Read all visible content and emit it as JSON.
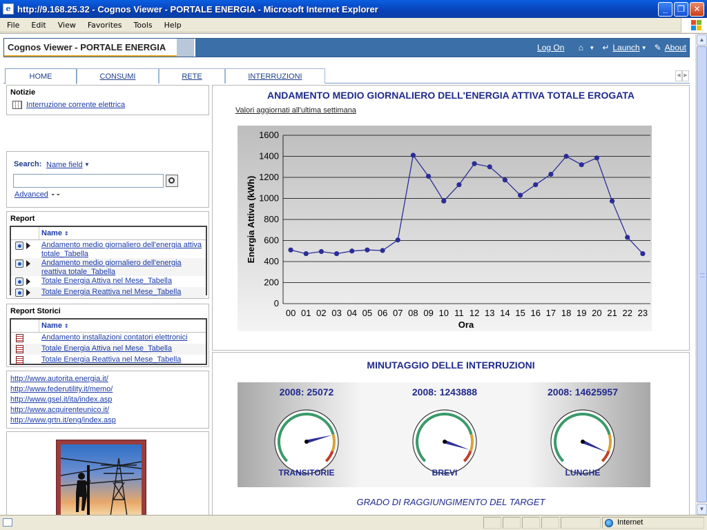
{
  "window": {
    "title": "http://9.168.25.32 - Cognos Viewer - PORTALE ENERGIA - Microsoft Internet Explorer",
    "menu": [
      "File",
      "Edit",
      "View",
      "Favorites",
      "Tools",
      "Help"
    ]
  },
  "header": {
    "brand": "Cognos Viewer - PORTALE ENERGIA",
    "log_on": "Log On",
    "launch": "Launch",
    "about": "About"
  },
  "tabs": [
    {
      "label": "HOME",
      "active": true
    },
    {
      "label": "CONSUMI",
      "active": false
    },
    {
      "label": "RETE",
      "active": false
    },
    {
      "label": "INTERRUZIONI",
      "active": false
    }
  ],
  "notizie": {
    "title": "Notizie",
    "item": "Interruzione corrente elettrica"
  },
  "search": {
    "label": "Search:",
    "field_selector": "Name field",
    "value": "",
    "advanced": "Advanced"
  },
  "report": {
    "title": "Report",
    "column": "Name",
    "items": [
      "Andamento medio giornaliero dell'energia attiva totale_Tabella",
      "Andamento medio giornaliero dell'energia reattiva totale_Tabella",
      "Totale Energia Attiva nel Mese_Tabella",
      "Totale Energia Reattiva nel Mese_Tabella"
    ]
  },
  "report_storici": {
    "title": "Report Storici",
    "column": "Name",
    "items": [
      "Andamento installazioni contatori elettronici",
      "Totale Energia Attiva nel Mese_Tabella",
      "Totale Energia Reattiva nel Mese_Tabella"
    ]
  },
  "links": [
    "http://www.autorita.energia.it/",
    "http://www.federutility.it/memo/",
    "http://www.gsel.it/ita/index.asp",
    "http://www.acquirenteunico.it/",
    "http://www.grtn.it/eng/index.asp"
  ],
  "chart_data": [
    {
      "type": "line",
      "title": "ANDAMENTO MEDIO GIORNALIERO DELL'ENERGIA ATTIVA TOTALE EROGATA",
      "subtitle": "Valori aggiornati all'ultima settimana",
      "xlabel": "Ora",
      "ylabel": "Energia Attiva (kWh)",
      "ylim": [
        0,
        1600
      ],
      "yticks": [
        0,
        200,
        400,
        600,
        800,
        1000,
        1200,
        1400,
        1600
      ],
      "grid": true,
      "categories": [
        "00",
        "01",
        "02",
        "03",
        "04",
        "05",
        "06",
        "07",
        "08",
        "09",
        "10",
        "11",
        "12",
        "13",
        "14",
        "15",
        "16",
        "17",
        "18",
        "19",
        "20",
        "21",
        "22",
        "23"
      ],
      "values": [
        510,
        475,
        495,
        475,
        500,
        510,
        505,
        605,
        1410,
        1210,
        975,
        1130,
        1330,
        1300,
        1175,
        1030,
        1130,
        1230,
        1400,
        1320,
        1385,
        975,
        630,
        475
      ],
      "color": "#2b2d96"
    },
    {
      "type": "gauge",
      "title": "MINUTAGGIO DELLE INTERRUZIONI",
      "footer": "GRADO DI RAGGIUNGIMENTO DEL TARGET",
      "gauges": [
        {
          "value_label": "2008: 25072",
          "name": "TRANSITORIE",
          "level": 0.78
        },
        {
          "value_label": "2008: 1243888",
          "name": "BREVI",
          "level": 0.9
        },
        {
          "value_label": "2008: 14625957",
          "name": "LUNGHE",
          "level": 0.92
        }
      ]
    }
  ],
  "status": {
    "zone": "Internet"
  }
}
